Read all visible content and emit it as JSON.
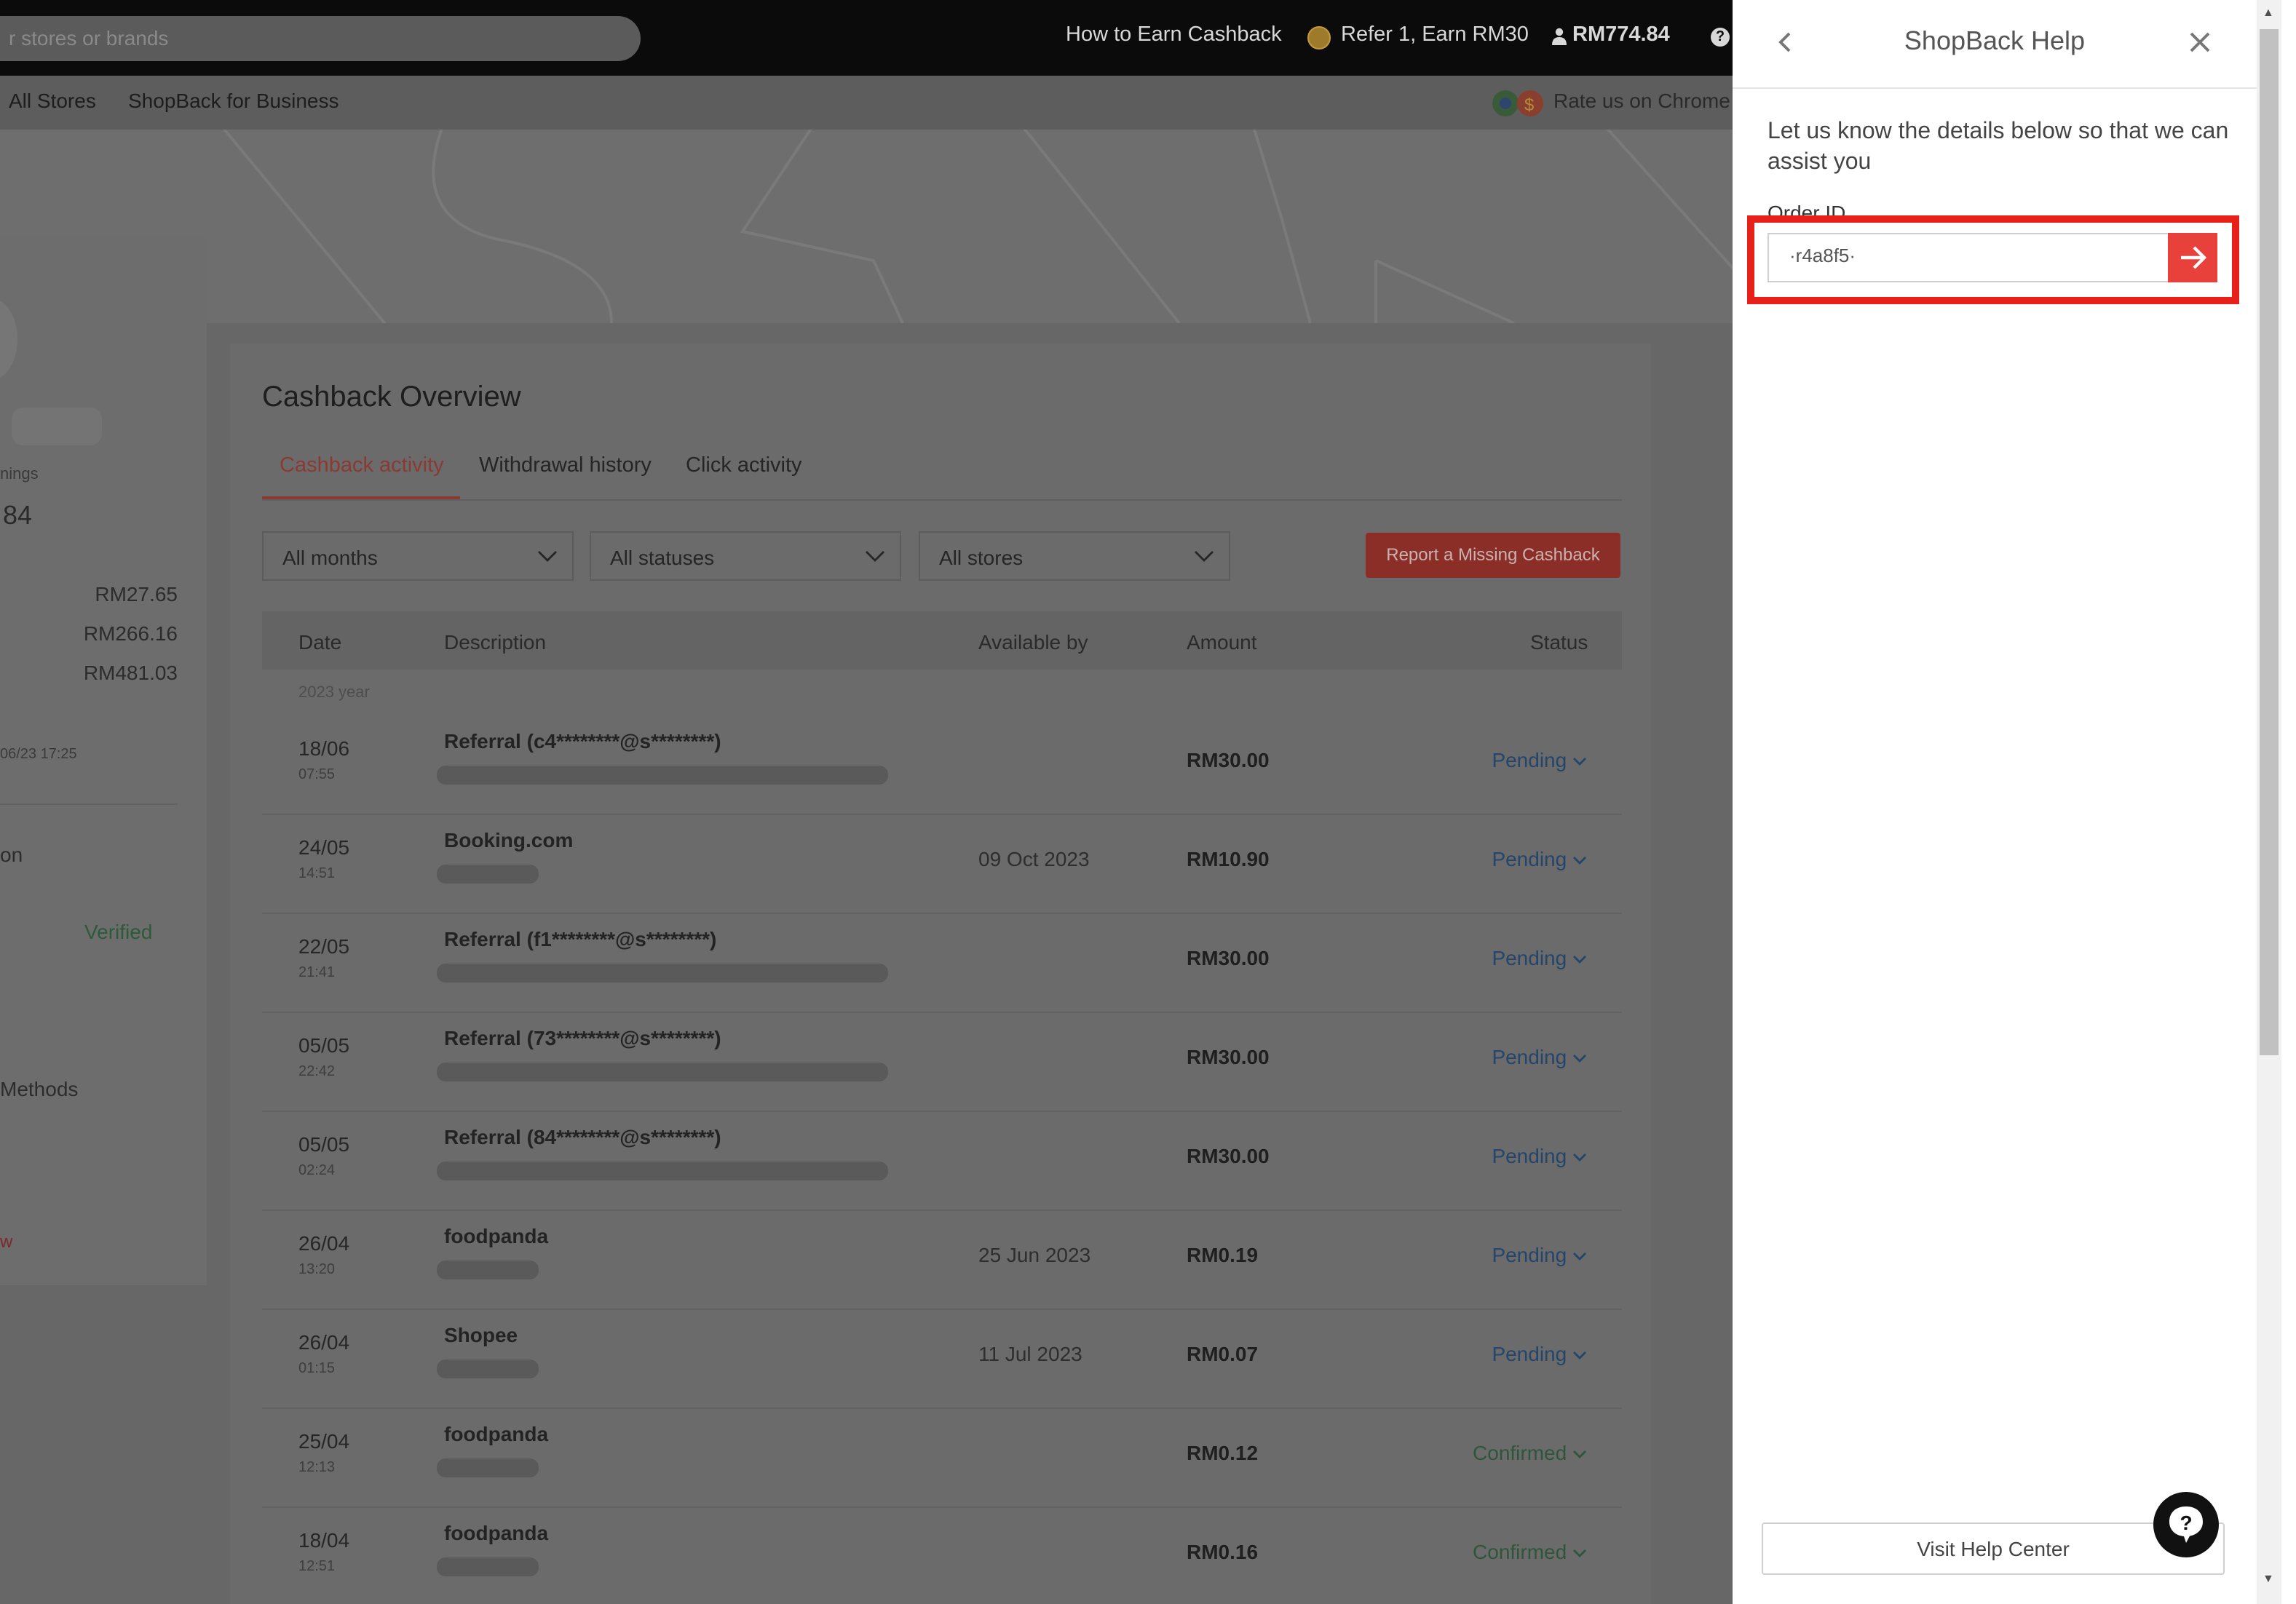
{
  "topbar": {
    "search_placeholder": "r stores or brands",
    "how_to": "How to Earn Cashback",
    "refer": "Refer 1, Earn RM30",
    "balance": "RM774.84"
  },
  "nav": {
    "all_stores": "All Stores",
    "business": "ShopBack for Business",
    "rate_chrome": "Rate us on Chrome"
  },
  "left": {
    "earnings_label": "nings",
    "earnings_value": "84",
    "amounts": [
      "RM27.65",
      "RM266.16",
      "RM481.03"
    ],
    "date_text": "06/23 17:25",
    "section_label": "on",
    "verified": "Verified",
    "methods": "Methods",
    "red_char": "w"
  },
  "overview": {
    "title": "Cashback Overview",
    "tabs": [
      "Cashback activity",
      "Withdrawal history",
      "Click activity"
    ],
    "filters": [
      "All months",
      "All statuses",
      "All stores"
    ],
    "report_btn": "Report a Missing Cashback",
    "columns": [
      "Date",
      "Description",
      "Available by",
      "Amount",
      "Status"
    ],
    "year_label": "2023 year",
    "rows": [
      {
        "date": "18/06",
        "time": "07:55",
        "desc": "Referral (c4********@s********)",
        "available": "",
        "amount": "RM30.00",
        "status": "Pending"
      },
      {
        "date": "24/05",
        "time": "14:51",
        "desc": "Booking.com",
        "available": "09 Oct 2023",
        "amount": "RM10.90",
        "status": "Pending"
      },
      {
        "date": "22/05",
        "time": "21:41",
        "desc": "Referral (f1********@s********)",
        "available": "",
        "amount": "RM30.00",
        "status": "Pending"
      },
      {
        "date": "05/05",
        "time": "22:42",
        "desc": "Referral (73********@s********)",
        "available": "",
        "amount": "RM30.00",
        "status": "Pending"
      },
      {
        "date": "05/05",
        "time": "02:24",
        "desc": "Referral (84********@s********)",
        "available": "",
        "amount": "RM30.00",
        "status": "Pending"
      },
      {
        "date": "26/04",
        "time": "13:20",
        "desc": "foodpanda",
        "available": "25 Jun 2023",
        "amount": "RM0.19",
        "status": "Pending"
      },
      {
        "date": "26/04",
        "time": "01:15",
        "desc": "Shopee",
        "available": "11 Jul 2023",
        "amount": "RM0.07",
        "status": "Pending"
      },
      {
        "date": "25/04",
        "time": "12:13",
        "desc": "foodpanda",
        "available": "",
        "amount": "RM0.12",
        "status": "Confirmed"
      },
      {
        "date": "18/04",
        "time": "12:51",
        "desc": "foodpanda",
        "available": "",
        "amount": "RM0.16",
        "status": "Confirmed"
      }
    ]
  },
  "help_panel": {
    "title": "ShopBack Help",
    "intro": "Let us know the details below so that we can assist you",
    "order_label": "Order ID",
    "order_value": "·r4a8f5·",
    "visit_btn": "Visit Help Center"
  },
  "colors": {
    "accent": "#e8403a",
    "highlight": "#e8201a",
    "pending": "#25456a",
    "confirmed": "#2f553a"
  }
}
